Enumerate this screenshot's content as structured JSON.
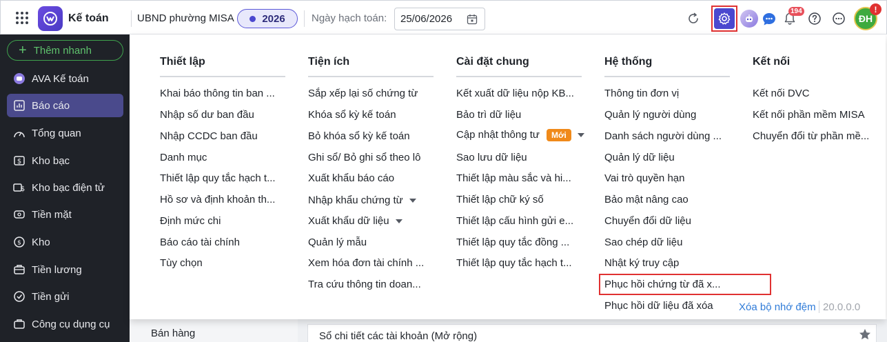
{
  "app": {
    "title": "Kế toán"
  },
  "header": {
    "org_name": "UBND phường MISA",
    "year": "2026",
    "date_label": "Ngày hạch toán:",
    "date_value": "25/06/2026",
    "notification_count": "194",
    "user_initials": "ĐH",
    "user_alert": "!"
  },
  "sidebar": {
    "quick_add_label": "Thêm nhanh",
    "items": [
      {
        "label": "AVA Kế toán",
        "icon": "ava-icon"
      },
      {
        "label": "Báo cáo",
        "icon": "report-icon",
        "active": true
      },
      {
        "label": "Tổng quan",
        "icon": "overview-icon"
      },
      {
        "label": "Kho bạc",
        "icon": "treasury-icon"
      },
      {
        "label": "Kho bạc điện tử",
        "icon": "e-treasury-icon"
      },
      {
        "label": "Tiền mặt",
        "icon": "cash-icon"
      },
      {
        "label": "Kho",
        "icon": "warehouse-icon"
      },
      {
        "label": "Tiền lương",
        "icon": "salary-icon"
      },
      {
        "label": "Tiền gửi",
        "icon": "deposit-icon"
      },
      {
        "label": "Công cụ dụng cụ",
        "icon": "tools-icon"
      }
    ]
  },
  "menu": {
    "columns": [
      {
        "title": "Thiết lập",
        "items": [
          "Khai báo thông tin ban ...",
          "Nhập số dư ban đầu",
          "Nhập CCDC ban đầu",
          "Danh mục",
          "Thiết lập quy tắc hạch t...",
          "Hồ sơ và định khoản th...",
          "Định mức chi",
          "Báo cáo tài chính",
          "Tùy chọn"
        ]
      },
      {
        "title": "Tiện ích",
        "items": [
          "Sắp xếp lại số chứng từ",
          "Khóa sổ kỳ kế toán",
          "Bỏ khóa sổ kỳ kế toán",
          "Ghi sổ/ Bỏ ghi sổ theo lô",
          "Xuất khẩu báo cáo",
          "Nhập khẩu chứng từ",
          "Xuất khẩu dữ liệu",
          "Quản lý mẫu",
          "Xem hóa đơn tài chính ...",
          "Tra cứu thông tin doan..."
        ]
      },
      {
        "title": "Cài đặt chung",
        "items": [
          "Kết xuất dữ liệu nộp KB...",
          "Bảo trì dữ liệu",
          "Cập nhật thông tư",
          "Sao lưu dữ liệu",
          "Thiết lập màu sắc và hi...",
          "Thiết lập chữ ký số",
          "Thiết lập cấu hình gửi e...",
          "Thiết lập quy tắc đồng ...",
          "Thiết lập quy tắc hạch t..."
        ],
        "new_badge": "Mới"
      },
      {
        "title": "Hệ thống",
        "items": [
          "Thông tin đơn vị",
          "Quản lý người dùng",
          "Danh sách người dùng ...",
          "Quản lý dữ liệu",
          "Vai trò quyền hạn",
          "Bảo mật nâng cao",
          "Chuyển đổi dữ liệu",
          "Sao chép dữ liệu",
          "Nhật ký truy cập",
          "Phục hồi chứng từ đã x...",
          "Phục hồi dữ liệu đã xóa"
        ]
      },
      {
        "title": "Kết nối",
        "items": [
          "Kết nối DVC",
          "Kết nối phần mềm MISA",
          "Chuyển đổi từ phần mề..."
        ]
      }
    ],
    "clear_cache_label": "Xóa bộ nhớ đệm",
    "version": "20.0.0.0"
  },
  "background": {
    "left_item": "Bán hàng",
    "card_title": "Sổ chi tiết các tài khoản (Mở rộng)"
  },
  "colors": {
    "accent": "#4b48cf",
    "highlight": "#e03131",
    "sidebar_bg": "#1f2228",
    "new_badge": "#f08a1a"
  }
}
